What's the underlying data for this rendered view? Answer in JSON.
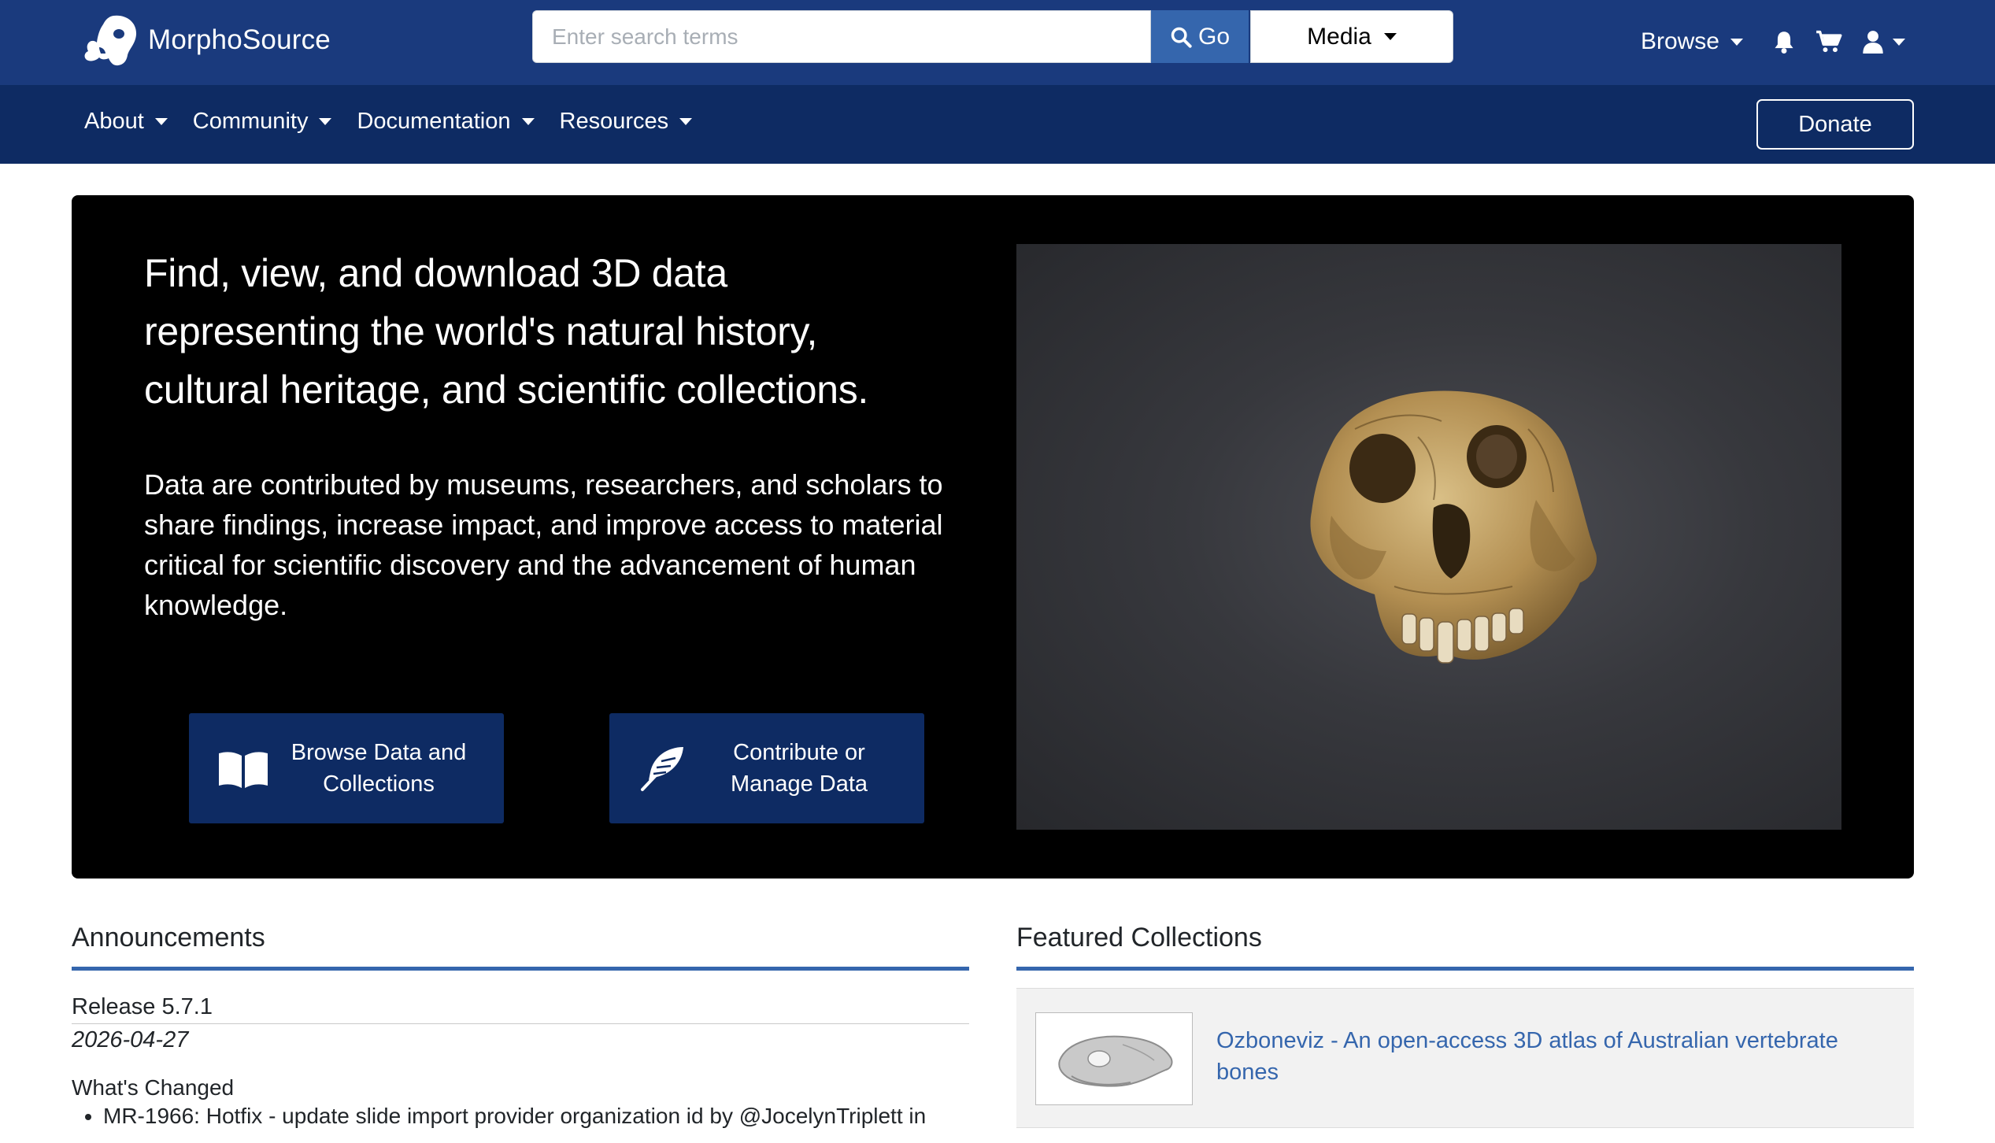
{
  "app": {
    "brand_name": "MorphoSource",
    "logo_icon": "morphosource-skull-logo"
  },
  "header": {
    "search_placeholder": "Enter search terms",
    "search_value": "",
    "go_label": "Go",
    "search_type_selected": "Media",
    "browse_label": "Browse",
    "icons": [
      "bell-icon",
      "cart-icon",
      "user-icon"
    ]
  },
  "subnav": {
    "items": [
      {
        "label": "About"
      },
      {
        "label": "Community"
      },
      {
        "label": "Documentation"
      },
      {
        "label": "Resources"
      }
    ],
    "donate_label": "Donate"
  },
  "hero": {
    "title": "Find, view, and download 3D data representing the world's natural history, cultural heritage, and scientific collections.",
    "description": "Data are contributed by museums, researchers, and scholars to share findings, increase impact, and improve access to material critical for scientific discovery and the advancement of human knowledge.",
    "cta_browse_line1": "Browse Data and",
    "cta_browse_line2": "Collections",
    "cta_contribute_line1": "Contribute or",
    "cta_contribute_line2": "Manage Data",
    "image_subject": "3D skull render"
  },
  "announcements": {
    "heading": "Announcements",
    "release_title": "Release 5.7.1",
    "release_date": "2026-04-27",
    "changes_heading": "What's Changed",
    "changes": [
      "MR-1966: Hotfix - update slide import provider organization id by @JocelynTriplett in"
    ]
  },
  "featured": {
    "heading": "Featured Collections",
    "items": [
      {
        "title": "Ozboneviz - An open-access 3D atlas of Australian vertebrate bones"
      }
    ]
  },
  "colors": {
    "topbar": "#1a3a7d",
    "subbar": "#0e2b63",
    "accent": "#3566ad",
    "hero_bg": "#000000",
    "link": "#3566ad"
  }
}
